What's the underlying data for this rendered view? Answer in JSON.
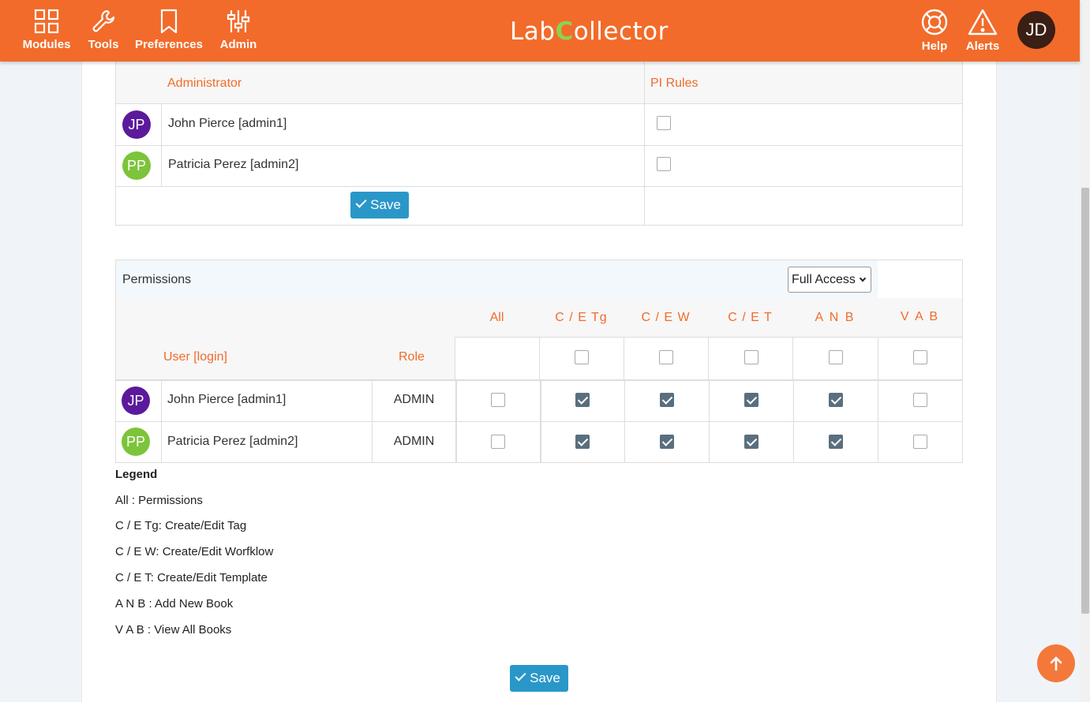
{
  "nav": {
    "left": [
      {
        "label": "Modules",
        "icon": "grid-icon"
      },
      {
        "label": "Tools",
        "icon": "wrench-icon"
      },
      {
        "label": "Preferences",
        "icon": "bookmark-icon"
      },
      {
        "label": "Admin",
        "icon": "sliders-icon"
      }
    ],
    "logo_pre": "Lab",
    "logo_c": "C",
    "logo_post": "ollector",
    "help": "Help",
    "alerts": "Alerts",
    "user_initials": "JD"
  },
  "admin_table": {
    "col_admin": "Administrator",
    "col_pi": "PI Rules",
    "rows": [
      {
        "initials": "JP",
        "name": "John Pierce [admin1]",
        "pi": false
      },
      {
        "initials": "PP",
        "name": "Patricia Perez [admin2]",
        "pi": false
      }
    ],
    "save": "Save"
  },
  "permissions": {
    "title": "Permissions",
    "access_select": "Full Access",
    "col_user": "User [login]",
    "col_role": "Role",
    "columns": [
      "All",
      "C / E Tg",
      "C / E W",
      "C / E T",
      "A N B",
      "V A B"
    ],
    "rows": [
      {
        "initials": "JP",
        "name": "John Pierce [admin1]",
        "role": "ADMIN",
        "checks": [
          false,
          true,
          true,
          true,
          true,
          false
        ]
      },
      {
        "initials": "PP",
        "name": "Patricia Perez [admin2]",
        "role": "ADMIN",
        "checks": [
          false,
          true,
          true,
          true,
          true,
          false
        ]
      }
    ]
  },
  "legend": {
    "title": "Legend",
    "items": [
      "All : Permissions",
      "C / E Tg: Create/Edit Tag",
      "C / E W: Create/Edit Worfklow",
      "C / E T: Create/Edit Template",
      "A N B : Add New Book",
      "V A B : View All Books"
    ]
  },
  "save_bottom": "Save",
  "colors": {
    "brand": "#f26b2a",
    "button": "#2a97c9",
    "checked": "#5a6f7e"
  }
}
